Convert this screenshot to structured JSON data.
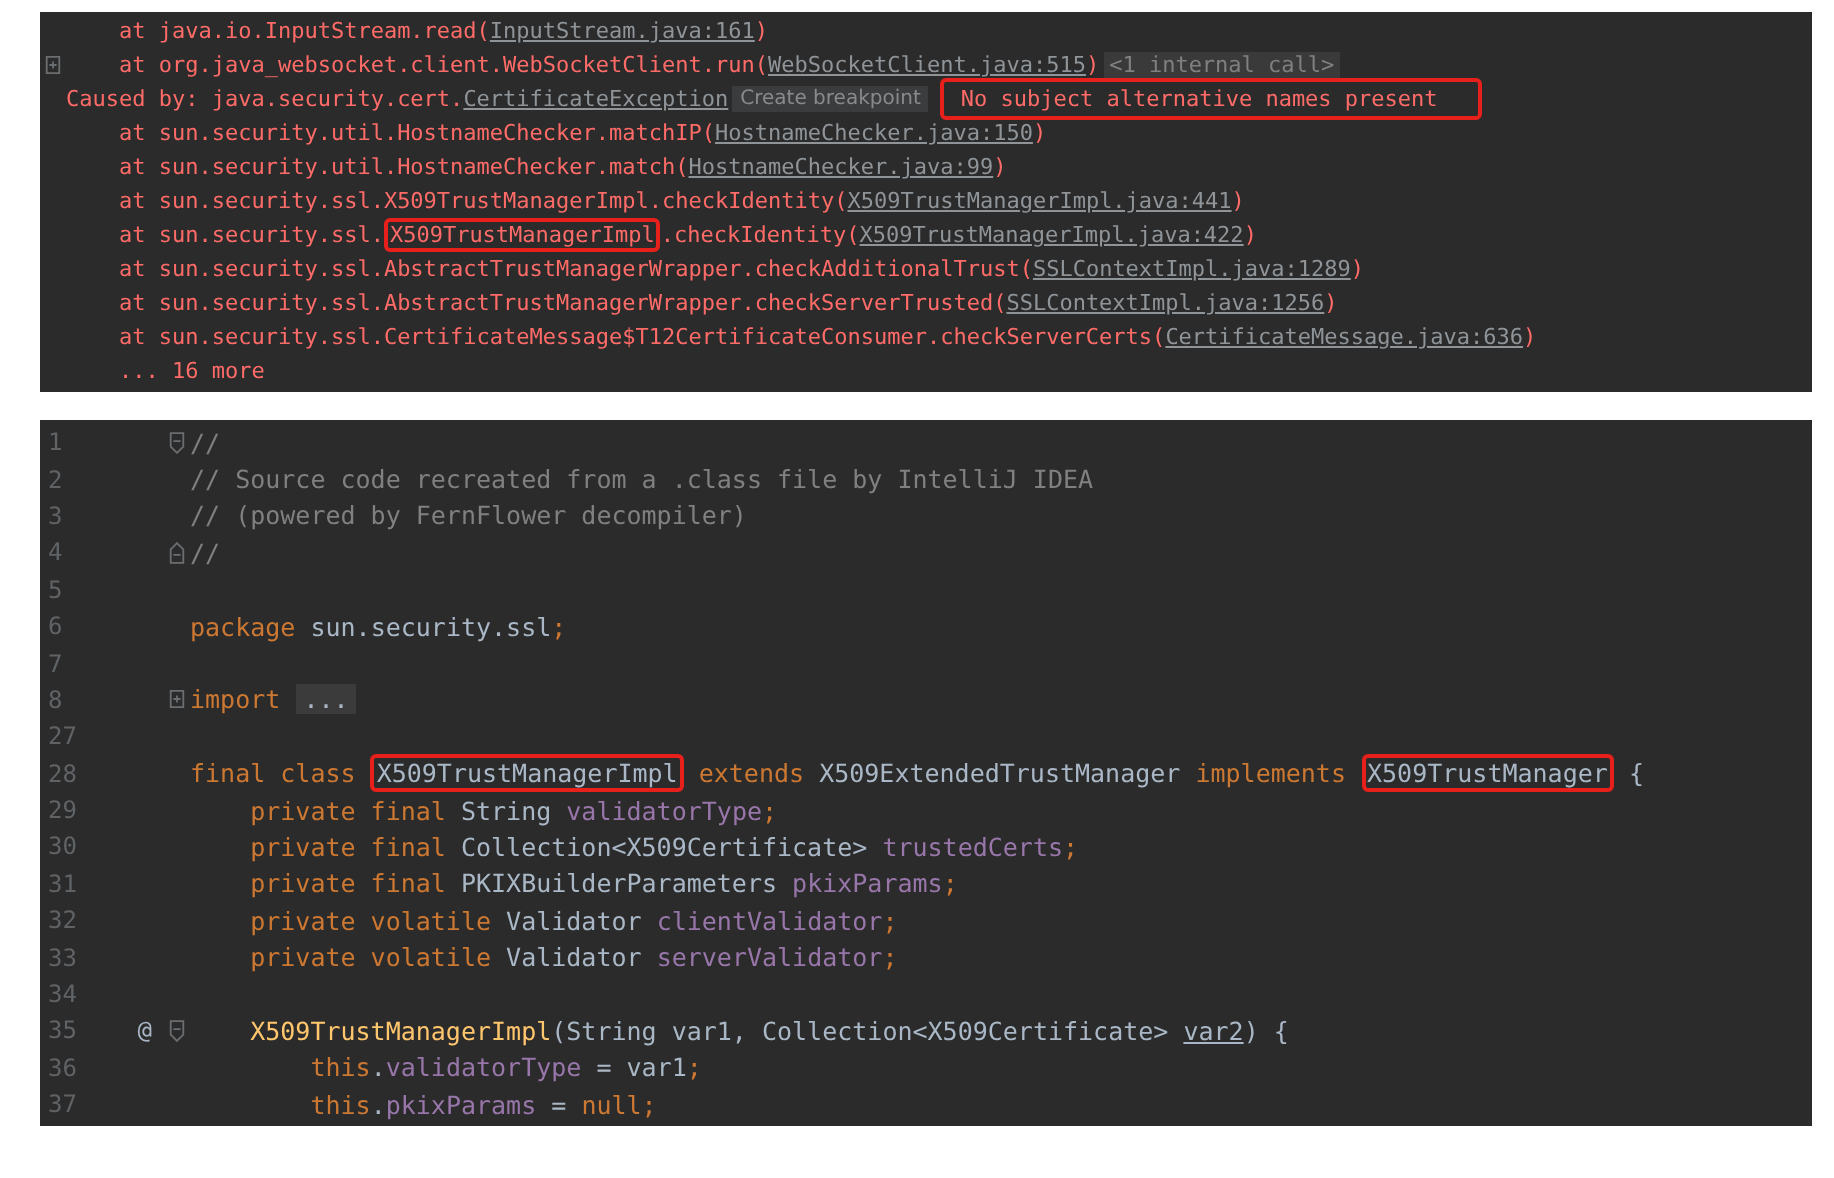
{
  "console": {
    "lines": [
      {
        "expandable": false,
        "tokens": [
          {
            "kind": "error",
            "text": "    at java.io.InputStream.read("
          },
          {
            "kind": "link",
            "text": "InputStream.java:161"
          },
          {
            "kind": "error",
            "text": ")"
          }
        ]
      },
      {
        "expandable": true,
        "tokens": [
          {
            "kind": "error",
            "text": "    at org.java_websocket.client.WebSocketClient.run("
          },
          {
            "kind": "link",
            "text": "WebSocketClient.java:515"
          },
          {
            "kind": "error",
            "text": ")"
          },
          {
            "kind": "hint",
            "text": "<1 internal call>"
          }
        ]
      },
      {
        "expandable": false,
        "tokens": [
          {
            "kind": "error",
            "text": "Caused by: java.security.cert."
          },
          {
            "kind": "link",
            "text": "CertificateException"
          },
          {
            "kind": "chip",
            "text": "Create breakpoint"
          },
          {
            "kind": "message",
            "text": "No subject alternative names present",
            "boxed": true
          }
        ]
      },
      {
        "expandable": false,
        "tokens": [
          {
            "kind": "error",
            "text": "    at sun.security.util.HostnameChecker.matchIP("
          },
          {
            "kind": "link",
            "text": "HostnameChecker.java:150"
          },
          {
            "kind": "error",
            "text": ")"
          }
        ]
      },
      {
        "expandable": false,
        "tokens": [
          {
            "kind": "error",
            "text": "    at sun.security.util.HostnameChecker.match("
          },
          {
            "kind": "link",
            "text": "HostnameChecker.java:99"
          },
          {
            "kind": "error",
            "text": ")"
          }
        ]
      },
      {
        "expandable": false,
        "tokens": [
          {
            "kind": "error",
            "text": "    at sun.security.ssl.X509TrustManagerImpl.checkIdentity("
          },
          {
            "kind": "link",
            "text": "X509TrustManagerImpl.java:441"
          },
          {
            "kind": "error",
            "text": ")"
          }
        ]
      },
      {
        "expandable": false,
        "tokens": [
          {
            "kind": "error",
            "text": "    at sun.security.ssl."
          },
          {
            "kind": "error",
            "text": "X509TrustManagerImpl",
            "boxed": true
          },
          {
            "kind": "error",
            "text": ".checkIdentity("
          },
          {
            "kind": "link",
            "text": "X509TrustManagerImpl.java:422"
          },
          {
            "kind": "error",
            "text": ")"
          }
        ]
      },
      {
        "expandable": false,
        "tokens": [
          {
            "kind": "error",
            "text": "    at sun.security.ssl.AbstractTrustManagerWrapper.checkAdditionalTrust("
          },
          {
            "kind": "link",
            "text": "SSLContextImpl.java:1289"
          },
          {
            "kind": "error",
            "text": ")"
          }
        ]
      },
      {
        "expandable": false,
        "tokens": [
          {
            "kind": "error",
            "text": "    at sun.security.ssl.AbstractTrustManagerWrapper.checkServerTrusted("
          },
          {
            "kind": "link",
            "text": "SSLContextImpl.java:1256"
          },
          {
            "kind": "error",
            "text": ")"
          }
        ]
      },
      {
        "expandable": false,
        "tokens": [
          {
            "kind": "error",
            "text": "    at sun.security.ssl.CertificateMessage$T12CertificateConsumer.checkServerCerts("
          },
          {
            "kind": "link",
            "text": "CertificateMessage.java:636"
          },
          {
            "kind": "error",
            "text": ")"
          }
        ]
      },
      {
        "expandable": false,
        "tokens": [
          {
            "kind": "error",
            "text": "    ... 16 more"
          }
        ]
      }
    ]
  },
  "editor": {
    "lines": [
      {
        "number": "1",
        "fold_start": true,
        "tokens": [
          {
            "kind": "comment",
            "text": "//"
          }
        ]
      },
      {
        "number": "2",
        "tokens": [
          {
            "kind": "comment",
            "text": "// Source code recreated from a .class file by IntelliJ IDEA"
          }
        ]
      },
      {
        "number": "3",
        "tokens": [
          {
            "kind": "comment",
            "text": "// (powered by FernFlower decompiler)"
          }
        ]
      },
      {
        "number": "4",
        "fold_end": true,
        "tokens": [
          {
            "kind": "comment",
            "text": "//"
          }
        ]
      },
      {
        "number": "5"
      },
      {
        "number": "6",
        "tokens": [
          {
            "kind": "keyword",
            "text": "package "
          },
          {
            "kind": "plain",
            "text": "sun.security.ssl"
          },
          {
            "kind": "keyword",
            "text": ";"
          }
        ]
      },
      {
        "number": "7"
      },
      {
        "number": "8",
        "collapsed": true,
        "tokens": [
          {
            "kind": "keyword",
            "text": "import "
          },
          {
            "kind": "folded",
            "text": "..."
          }
        ]
      },
      {
        "number": "27"
      },
      {
        "number": "28",
        "tokens": [
          {
            "kind": "keyword",
            "text": "final class "
          },
          {
            "kind": "plain",
            "text": "X509TrustManagerImpl",
            "boxed": true
          },
          {
            "kind": "keyword",
            "text": " extends "
          },
          {
            "kind": "plain",
            "text": "X509ExtendedTrustManager"
          },
          {
            "kind": "keyword",
            "text": " implements "
          },
          {
            "kind": "plain",
            "text": "X509TrustManager",
            "boxed": true
          },
          {
            "kind": "plain",
            "text": " {"
          }
        ]
      },
      {
        "number": "29",
        "tokens": [
          {
            "kind": "keyword",
            "text": "    private final "
          },
          {
            "kind": "plain",
            "text": "String "
          },
          {
            "kind": "field",
            "text": "validatorType"
          },
          {
            "kind": "keyword",
            "text": ";"
          }
        ]
      },
      {
        "number": "30",
        "tokens": [
          {
            "kind": "keyword",
            "text": "    private final "
          },
          {
            "kind": "plain",
            "text": "Collection<X509Certificate> "
          },
          {
            "kind": "field",
            "text": "trustedCerts"
          },
          {
            "kind": "keyword",
            "text": ";"
          }
        ]
      },
      {
        "number": "31",
        "tokens": [
          {
            "kind": "keyword",
            "text": "    private final "
          },
          {
            "kind": "plain",
            "text": "PKIXBuilderParameters "
          },
          {
            "kind": "field",
            "text": "pkixParams"
          },
          {
            "kind": "keyword",
            "text": ";"
          }
        ]
      },
      {
        "number": "32",
        "tokens": [
          {
            "kind": "keyword",
            "text": "    private volatile "
          },
          {
            "kind": "plain",
            "text": "Validator "
          },
          {
            "kind": "field",
            "text": "clientValidator"
          },
          {
            "kind": "keyword",
            "text": ";"
          }
        ]
      },
      {
        "number": "33",
        "tokens": [
          {
            "kind": "keyword",
            "text": "    private volatile "
          },
          {
            "kind": "plain",
            "text": "Validator "
          },
          {
            "kind": "field",
            "text": "serverValidator"
          },
          {
            "kind": "keyword",
            "text": ";"
          }
        ]
      },
      {
        "number": "34"
      },
      {
        "number": "35",
        "fold_start": true,
        "annotation": "@",
        "tokens": [
          {
            "kind": "method",
            "text": "    X509TrustManagerImpl"
          },
          {
            "kind": "plain",
            "text": "(String var1, Collection<X509Certificate> "
          },
          {
            "kind": "underlined",
            "text": "var2"
          },
          {
            "kind": "plain",
            "text": ") {"
          }
        ]
      },
      {
        "number": "36",
        "tokens": [
          {
            "kind": "keyword",
            "text": "        this"
          },
          {
            "kind": "plain",
            "text": "."
          },
          {
            "kind": "field",
            "text": "validatorType"
          },
          {
            "kind": "plain",
            "text": " = var1"
          },
          {
            "kind": "keyword",
            "text": ";"
          }
        ]
      },
      {
        "number": "37",
        "tokens": [
          {
            "kind": "keyword",
            "text": "        this"
          },
          {
            "kind": "plain",
            "text": "."
          },
          {
            "kind": "field",
            "text": "pkixParams"
          },
          {
            "kind": "plain",
            "text": " = "
          },
          {
            "kind": "keyword",
            "text": "null;"
          }
        ]
      }
    ]
  }
}
